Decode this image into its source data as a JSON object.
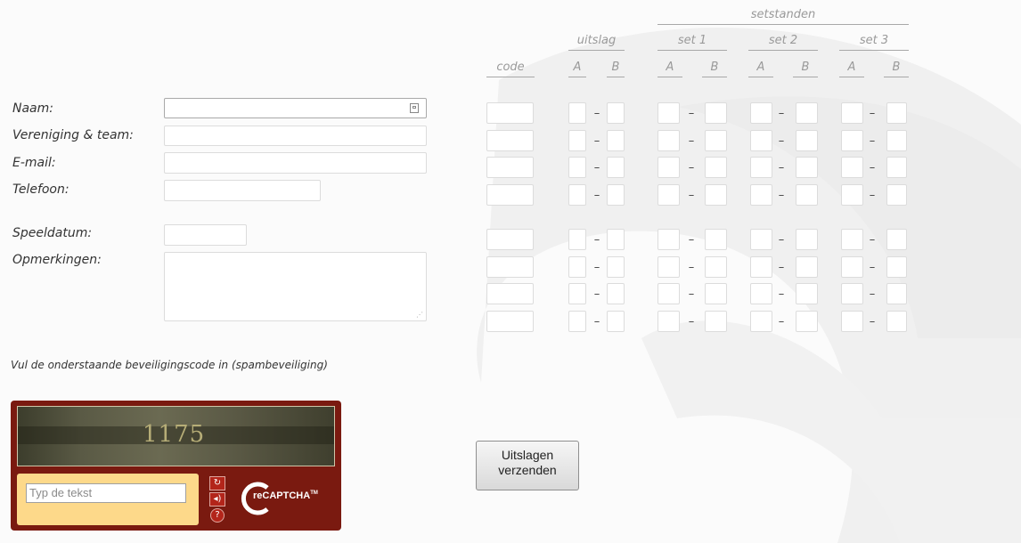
{
  "form": {
    "labels": {
      "name": "Naam:",
      "club_team": "Vereniging & team:",
      "email": "E-mail:",
      "phone": "Telefoon:",
      "play_date": "Speeldatum:",
      "remarks": "Opmerkingen:"
    },
    "captcha_instruction": "Vul de onderstaande beveiligingscode in (spambeveiliging)"
  },
  "results_table": {
    "group_header": "setstanden",
    "headers": {
      "code": "code",
      "uitslag": "uitslag",
      "set1": "set 1",
      "set2": "set 2",
      "set3": "set 3",
      "A": "A",
      "B": "B"
    },
    "dash": "–"
  },
  "submit": {
    "line1": "Uitslagen",
    "line2": "verzenden"
  },
  "captcha": {
    "image_text": "1175",
    "input_placeholder": "Typ de tekst",
    "logo_text": "reCAPTCHA",
    "logo_tm": "TM"
  }
}
